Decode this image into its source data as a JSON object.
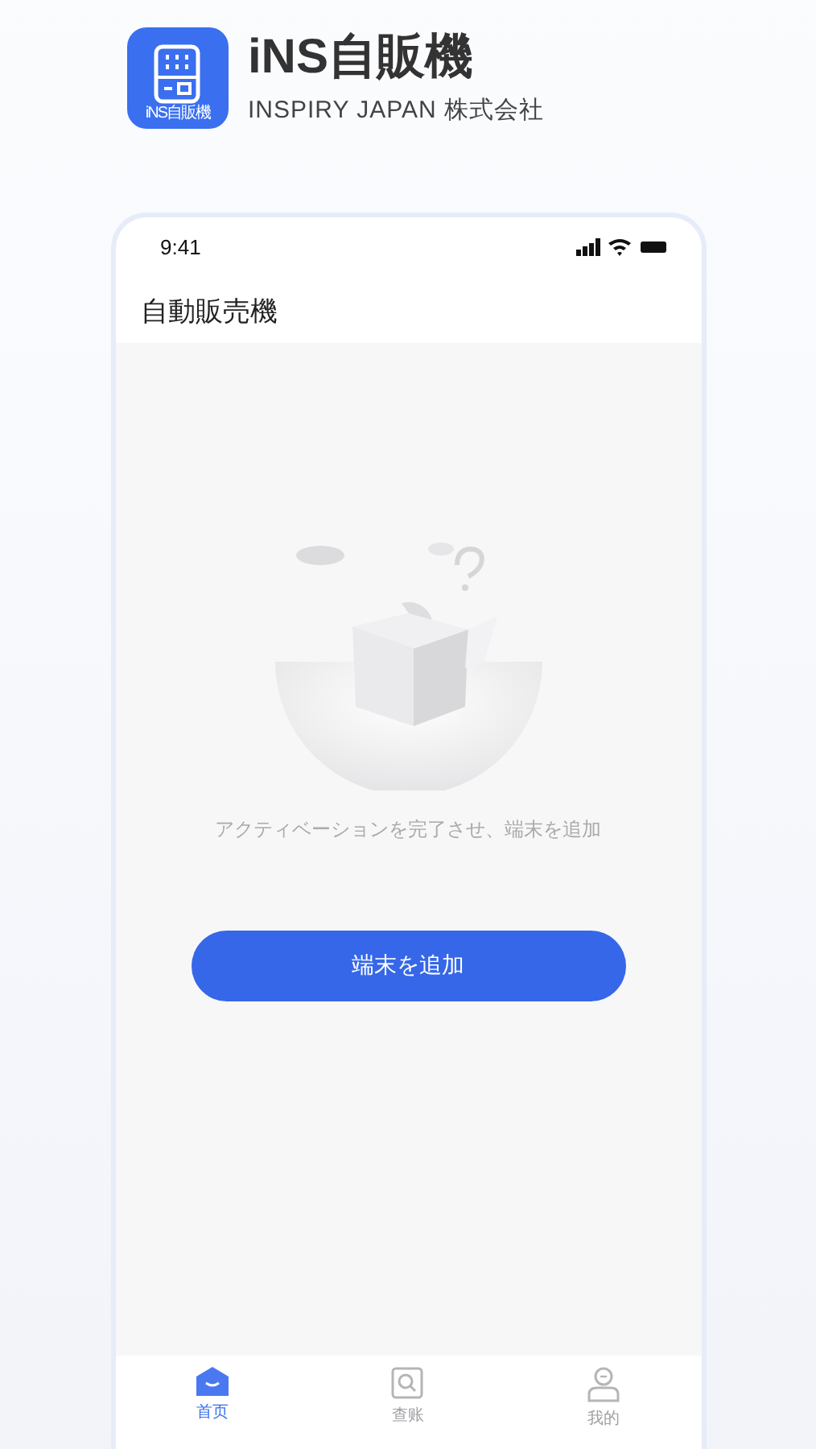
{
  "header": {
    "logo_caption": "iNS自販機",
    "title": "iNS自販機",
    "subtitle": "INSPIRY JAPAN 株式会社"
  },
  "status_bar": {
    "time": "9:41"
  },
  "nav_title": "自動販売機",
  "empty_state": {
    "message": "アクティベーションを完了させ、端末を追加"
  },
  "add_button": "端末を追加",
  "tabs": [
    {
      "label": "首页",
      "kind": "home",
      "selected": true
    },
    {
      "label": "查账",
      "kind": "search",
      "selected": false
    },
    {
      "label": "我的",
      "kind": "profile",
      "selected": false
    }
  ]
}
